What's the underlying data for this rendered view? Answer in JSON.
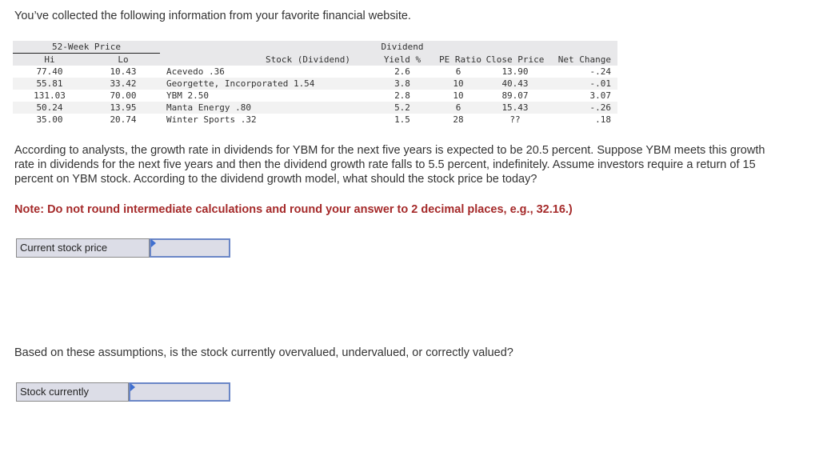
{
  "intro": "You’ve collected the following information from your favorite financial website.",
  "table": {
    "group_header": "52-Week Price",
    "dividend_header_line1": "Dividend",
    "columns": {
      "hi": "Hi",
      "lo": "Lo",
      "stock": "Stock (Dividend)",
      "yield": "Yield %",
      "pe": "PE Ratio",
      "close": "Close Price",
      "net": "Net Change"
    },
    "rows": [
      {
        "hi": "77.40",
        "lo": "10.43",
        "stock": "Acevedo .36",
        "yield": "2.6",
        "pe": "6",
        "close": "13.90",
        "net": "-.24"
      },
      {
        "hi": "55.81",
        "lo": "33.42",
        "stock": "Georgette, Incorporated 1.54",
        "yield": "3.8",
        "pe": "10",
        "close": "40.43",
        "net": "-.01"
      },
      {
        "hi": "131.03",
        "lo": "70.00",
        "stock": "YBM 2.50",
        "yield": "2.8",
        "pe": "10",
        "close": "89.07",
        "net": "3.07"
      },
      {
        "hi": "50.24",
        "lo": "13.95",
        "stock": "Manta Energy .80",
        "yield": "5.2",
        "pe": "6",
        "close": "15.43",
        "net": "-.26"
      },
      {
        "hi": "35.00",
        "lo": "20.74",
        "stock": "Winter Sports .32",
        "yield": "1.5",
        "pe": "28",
        "close": "??",
        "net": ".18"
      }
    ]
  },
  "question": "According to analysts, the growth rate in dividends for YBM for the next five years is expected to be 20.5 percent. Suppose YBM meets this growth rate in dividends for the next five years and then the dividend growth rate falls to 5.5 percent, indefinitely. Assume investors require a return of 15 percent on YBM stock. According to the dividend growth model, what should the stock price be today?",
  "note": "Note: Do not round intermediate calculations and round your answer to 2 decimal places, e.g., 32.16.)",
  "answer_price": {
    "label": "Current stock price",
    "value": ""
  },
  "question2": "Based on these assumptions, is the stock currently overvalued, undervalued, or correctly valued?",
  "answer_status": {
    "label": "Stock currently",
    "value": ""
  }
}
